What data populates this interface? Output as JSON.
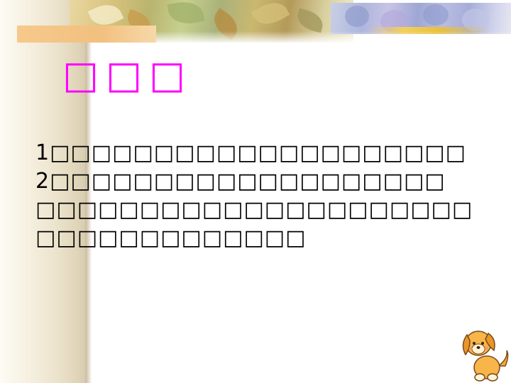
{
  "slide": {
    "title": "□□□",
    "lines": [
      "1□□□□□□□□□□□□□□□□□□□□",
      "2□□□□□□□□□□□□□□□□□□□",
      "□□□□□□□□□□□□□□□□□□□□□",
      "□□□□□□□□□□□□□"
    ]
  },
  "colors": {
    "title": "#ff00ff",
    "body_text": "#000000",
    "accent_bar": "#f6c98c",
    "background": "#ffffff"
  },
  "icons": {
    "banner_left": "autumn-leaves-banner",
    "banner_right": "blue-flowers-banner",
    "corner": "puppy-icon"
  }
}
